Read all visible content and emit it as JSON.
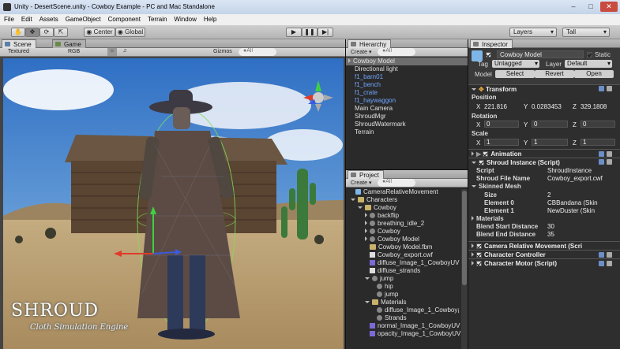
{
  "window": {
    "title": "Unity - DesertScene.unity - Cowboy Example - PC and Mac Standalone"
  },
  "menu": [
    "File",
    "Edit",
    "Assets",
    "GameObject",
    "Component",
    "Terrain",
    "Window",
    "Help"
  ],
  "toolbar": {
    "pivot": "Center",
    "space": "Global",
    "layers": "Layers",
    "layout": "Tall"
  },
  "scene": {
    "tab_scene": "Scene",
    "tab_game": "Game",
    "render_mode": "Textured",
    "color_mode": "RGB",
    "gizmos": "Gizmos",
    "search": "●All",
    "watermark_title": "SHROUD",
    "watermark_sub": "Cloth Simulation Engine"
  },
  "hierarchy": {
    "title": "Hierarchy",
    "create": "Create",
    "search": "●All",
    "items": [
      {
        "label": "Cowboy Model",
        "blue": false,
        "selected": true,
        "arrow": true
      },
      {
        "label": "Directional light",
        "blue": false
      },
      {
        "label": "f1_barn01",
        "blue": true
      },
      {
        "label": "f1_bench",
        "blue": true
      },
      {
        "label": "f1_crate",
        "blue": true
      },
      {
        "label": "f1_haywaggon",
        "blue": true
      },
      {
        "label": "Main Camera",
        "blue": false
      },
      {
        "label": "ShroudMgr",
        "blue": false
      },
      {
        "label": "ShroudWatermark",
        "blue": false
      },
      {
        "label": "Terrain",
        "blue": false
      }
    ]
  },
  "project": {
    "title": "Project",
    "create": "Create",
    "search": "●All",
    "items": [
      {
        "label": "CameraRelativeMovement",
        "indent": 0,
        "icon": "cicon",
        "arrow": ""
      },
      {
        "label": "Characters",
        "indent": 0,
        "icon": "ficon",
        "arrow": "down"
      },
      {
        "label": "Cowboy",
        "indent": 1,
        "icon": "ficon",
        "arrow": "down"
      },
      {
        "label": "backflip",
        "indent": 2,
        "icon": "gicon",
        "arrow": "right"
      },
      {
        "label": "breathing_idle_2",
        "indent": 2,
        "icon": "gicon",
        "arrow": "right"
      },
      {
        "label": "Cowboy",
        "indent": 2,
        "icon": "gicon",
        "arrow": "right"
      },
      {
        "label": "Cowboy Model",
        "indent": 2,
        "icon": "gicon",
        "arrow": "right"
      },
      {
        "label": "Cowboy Model.fbm",
        "indent": 2,
        "icon": "ficon",
        "arrow": ""
      },
      {
        "label": "Cowboy_export.cwf",
        "indent": 2,
        "icon": "wicon",
        "arrow": ""
      },
      {
        "label": "diffuse_Image_1_CowboyUV",
        "indent": 2,
        "icon": "micon",
        "arrow": ""
      },
      {
        "label": "diffuse_strands",
        "indent": 2,
        "icon": "wicon",
        "arrow": ""
      },
      {
        "label": "jump",
        "indent": 2,
        "icon": "gicon",
        "arrow": "down"
      },
      {
        "label": "hip",
        "indent": 3,
        "icon": "gicon",
        "arrow": ""
      },
      {
        "label": "jump",
        "indent": 3,
        "icon": "gicon",
        "arrow": ""
      },
      {
        "label": "Materials",
        "indent": 2,
        "icon": "ficon",
        "arrow": "down"
      },
      {
        "label": "diffuse_Image_1_Cowboy¡",
        "indent": 3,
        "icon": "gicon",
        "arrow": ""
      },
      {
        "label": "Strands",
        "indent": 3,
        "icon": "gicon",
        "arrow": ""
      },
      {
        "label": "normal_Image_1_CowboyUV",
        "indent": 2,
        "icon": "micon",
        "arrow": ""
      },
      {
        "label": "opacity_Image_1_CowboyUV",
        "indent": 2,
        "icon": "micon",
        "arrow": ""
      }
    ]
  },
  "inspector": {
    "title": "Inspector",
    "object_name": "Cowboy Model",
    "static": "Static",
    "tag_label": "Tag",
    "tag_value": "Untagged",
    "layer_label": "Layer",
    "layer_value": "Default",
    "model_label": "Model",
    "model_select": "Select",
    "model_revert": "Revert",
    "model_open": "Open",
    "transform": {
      "title": "Transform",
      "position": "Position",
      "rotation": "Rotation",
      "scale": "Scale",
      "pos": {
        "x": "221.816",
        "y": "0.0283453",
        "z": "329.1808"
      },
      "rot": {
        "x": "0",
        "y": "0",
        "z": "0"
      },
      "scl": {
        "x": "1",
        "y": "1",
        "z": "1"
      },
      "x": "X",
      "y": "Y",
      "z": "Z"
    },
    "animation": "Animation",
    "shroud": {
      "title": "Shroud Instance (Script)",
      "script_label": "Script",
      "script_value": "ShroudInstance",
      "file_label": "Shroud File Name",
      "file_value": "Cowboy_export.cwf",
      "skinned": "Skinned Mesh",
      "size_label": "Size",
      "size_value": "2",
      "el0_label": "Element 0",
      "el0_value": "CBBandana (Skin",
      "el1_label": "Element 1",
      "el1_value": "NewDuster (Skin",
      "materials": "Materials",
      "bsd_label": "Blend Start Distance",
      "bsd_value": "30",
      "bed_label": "Blend End Distance",
      "bed_value": "35"
    },
    "crm": "Camera Relative Movement (Scri",
    "cc": "Character Controller",
    "cm": "Character Motor (Script)"
  }
}
